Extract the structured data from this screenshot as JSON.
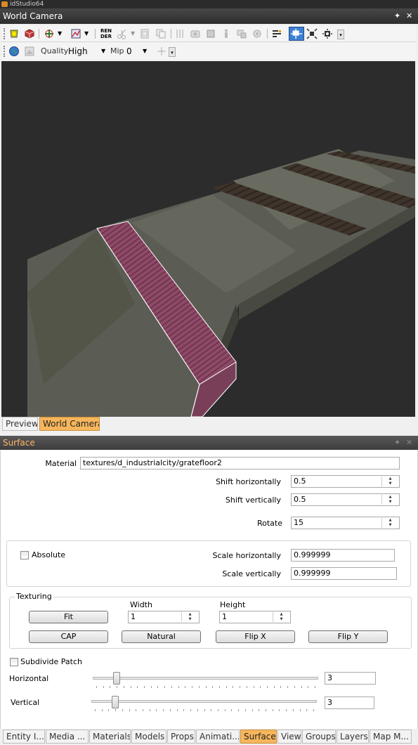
{
  "app": {
    "title": "idStudio64"
  },
  "camera_panel": {
    "title": "World Camera",
    "pin_glyph": "✦",
    "close_glyph": "✕",
    "toolbar1_icons": [
      "selection-mode-icon",
      "brush-icon",
      "transform-gizmo-icon",
      "view-mode-icon",
      "render-icon",
      "scissors-icon",
      "paste-icon",
      "copy-icon",
      "grid-icon",
      "camera-icon",
      "box-icon",
      "figure-icon",
      "mesh-icon",
      "light-icon",
      "filter-icon",
      "fit-view-icon",
      "expand-icon",
      "collapse-icon"
    ],
    "render_label": "REN DER",
    "quality_label": "Quality",
    "quality_value": "High",
    "mip_label": "Mip",
    "mip_value": "0"
  },
  "viewport_tabs": [
    {
      "label": "Preview",
      "active": false
    },
    {
      "label": "World Camera",
      "active": true
    }
  ],
  "surface": {
    "title": "Surface",
    "material_label": "Material",
    "material_value": "textures/d_industrialcity/gratefloor2",
    "shift_h_label": "Shift horizontally",
    "shift_h_value": "0.5",
    "shift_v_label": "Shift vertically",
    "shift_v_value": "0.5",
    "rotate_label": "Rotate",
    "rotate_value": "15",
    "absolute_label": "Absolute",
    "absolute_checked": false,
    "scale_h_label": "Scale horizontally",
    "scale_h_value": "0.999999",
    "scale_v_label": "Scale vertically",
    "scale_v_value": "0.999999",
    "texturing": {
      "title": "Texturing",
      "width_label": "Width",
      "width_value": "1",
      "height_label": "Height",
      "height_value": "1",
      "fit_label": "Fit",
      "cap_label": "CAP",
      "natural_label": "Natural",
      "flipx_label": "Flip X",
      "flipy_label": "Flip Y"
    },
    "subdivide_label": "Subdivide Patch",
    "subdivide_checked": false,
    "horizontal_label": "Horizontal",
    "horizontal_value": "3",
    "horizontal_level": 3,
    "vertical_label": "Vertical",
    "vertical_value": "3",
    "vertical_level": 3
  },
  "bottom_tabs": [
    {
      "label": "Entity I...",
      "active": false
    },
    {
      "label": "Media ...",
      "active": false
    },
    {
      "label": "Materials",
      "active": false
    },
    {
      "label": "Models",
      "active": false
    },
    {
      "label": "Props",
      "active": false
    },
    {
      "label": "Animati...",
      "active": false
    },
    {
      "label": "Surface",
      "active": true
    },
    {
      "label": "View",
      "active": false
    },
    {
      "label": "Groups",
      "active": false
    },
    {
      "label": "Layers",
      "active": false
    },
    {
      "label": "Map M...",
      "active": false
    }
  ],
  "colors": {
    "active_tab": "#f7b65c",
    "header_dark": "#333333",
    "surface_title": "#ffb468",
    "selection_outline": "#ffffff",
    "grate_material": "#8e4a66"
  }
}
